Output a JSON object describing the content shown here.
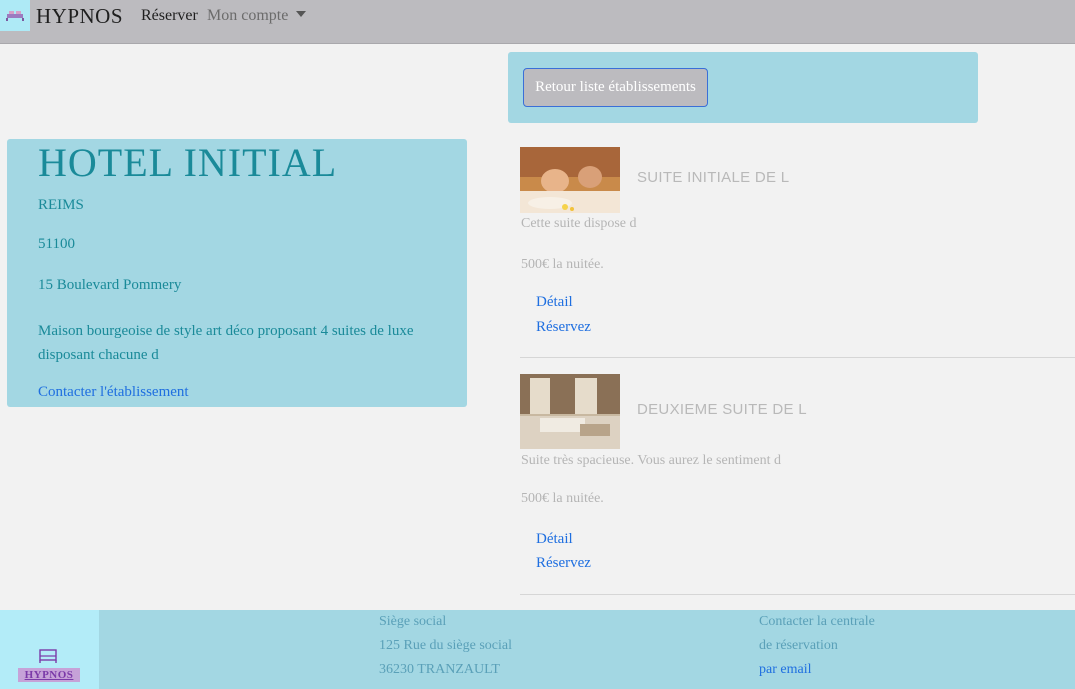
{
  "navbar": {
    "brand": "HYPNOS",
    "reserver": "Réserver",
    "account": "Mon compte"
  },
  "back_button": "Retour liste établissements",
  "hotel": {
    "name": "HOTEL INITIAL",
    "city": "REIMS",
    "zip": "51100",
    "address": "15 Boulevard Pommery",
    "description": "Maison bourgeoise de style art déco proposant 4 suites de luxe disposant chacune d",
    "contact": "Contacter l'établissement"
  },
  "suites": [
    {
      "title": "SUITE INITIALE DE L",
      "description": "Cette suite dispose d",
      "price": "500€ la nuitée.",
      "detail": "Détail",
      "reserve": "Réservez"
    },
    {
      "title": "DEUXIEME SUITE DE L",
      "description": "Suite très spacieuse. Vous aurez le sentiment d",
      "price": "500€ la nuitée.",
      "detail": "Détail",
      "reserve": "Réservez"
    }
  ],
  "footer": {
    "logo_text": "HYPNOS",
    "siege_title": "Siège social",
    "siege_street": "125 Rue du siège social",
    "siege_city": "36230 TRANZAULT",
    "contact_line1": "Contacter la centrale",
    "contact_line2": "de réservation",
    "contact_email": "par email"
  }
}
